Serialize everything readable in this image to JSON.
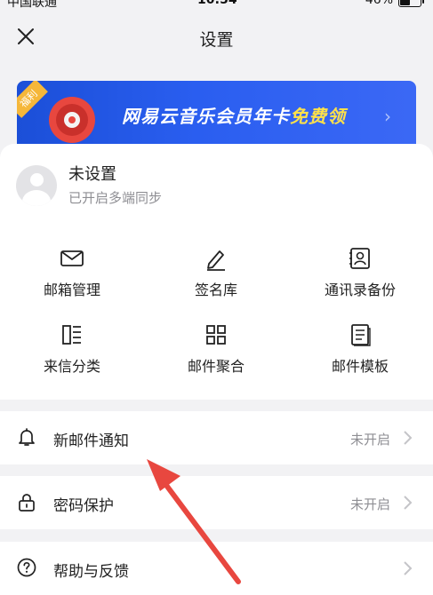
{
  "status_bar": {
    "carrier": "中国联通",
    "time": "10:54",
    "battery": "46%",
    "battery_level": 0.46
  },
  "nav": {
    "title": "设置",
    "close_icon": "close-icon"
  },
  "banner": {
    "ribbon": "福利",
    "text_main": "网易云音乐会员年卡",
    "text_accent": "免费领",
    "colors": {
      "background": "#2a5ef0",
      "accent": "#ffe14a"
    }
  },
  "profile": {
    "name": "未设置",
    "subtitle": "已开启多端同步"
  },
  "features": [
    {
      "label": "邮箱管理",
      "icon": "envelope-icon"
    },
    {
      "label": "签名库",
      "icon": "pen-icon"
    },
    {
      "label": "通讯录备份",
      "icon": "contacts-icon"
    },
    {
      "label": "来信分类",
      "icon": "categories-icon"
    },
    {
      "label": "邮件聚合",
      "icon": "grid-icon"
    },
    {
      "label": "邮件模板",
      "icon": "document-icon"
    }
  ],
  "settings_list": [
    {
      "label": "新邮件通知",
      "status": "未开启",
      "icon": "bell-icon"
    },
    {
      "label": "密码保护",
      "status": "未开启",
      "icon": "lock-icon"
    },
    {
      "label": "帮助与反馈",
      "status": "",
      "icon": "help-icon"
    }
  ],
  "colors": {
    "page_bg": "#f2f2f4",
    "annotation_arrow": "#e8473f"
  }
}
